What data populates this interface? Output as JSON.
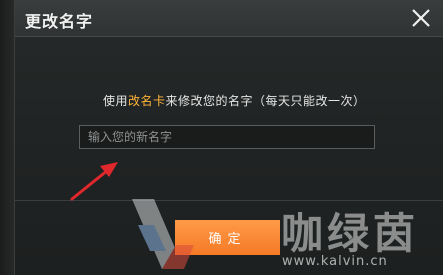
{
  "dialog": {
    "title": "更改名字",
    "close_icon": "close-icon",
    "prompt_before": "使用",
    "prompt_item": "改名卡",
    "prompt_after": "来修改您的名字（每天只能改一次）",
    "input": {
      "value": "",
      "placeholder": "输入您的新名字"
    },
    "confirm_label": "确定"
  },
  "annotation": {
    "arrow_icon": "red-arrow-icon",
    "color": "#e0282c"
  },
  "watermark": {
    "logo_icon": "kalvin-logo-icon",
    "site_name": "咖绿茵",
    "url": "www.kalvin.cn"
  },
  "colors": {
    "accent": "#f57a26",
    "highlight": "#ffb43a",
    "title_bar": "#333636",
    "dialog_bg": "#222525"
  }
}
